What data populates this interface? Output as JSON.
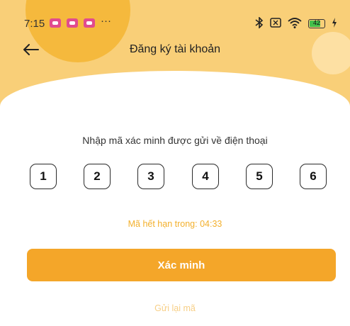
{
  "status_bar": {
    "time": "7:15",
    "more": "···",
    "battery_level": "42",
    "icons": [
      "notification-icon",
      "notification-icon",
      "notification-icon",
      "bluetooth-icon",
      "screen-icon",
      "wifi-icon",
      "battery-icon",
      "charging-icon"
    ]
  },
  "navbar": {
    "title": "Đăng ký tài khoản",
    "back_icon": "arrow-left-icon"
  },
  "main": {
    "instruction": "Nhập mã xác minh được gửi về điện thoại",
    "code_digits": [
      "1",
      "2",
      "3",
      "4",
      "5",
      "6"
    ],
    "expire_text": "Mã hết hạn trong: 04:33",
    "verify_button": "Xác minh",
    "resend_link": "Gửi lại mã"
  },
  "colors": {
    "accent": "#f4a629",
    "header_bg": "#f9cf78",
    "expire_text": "#f3b02c"
  }
}
